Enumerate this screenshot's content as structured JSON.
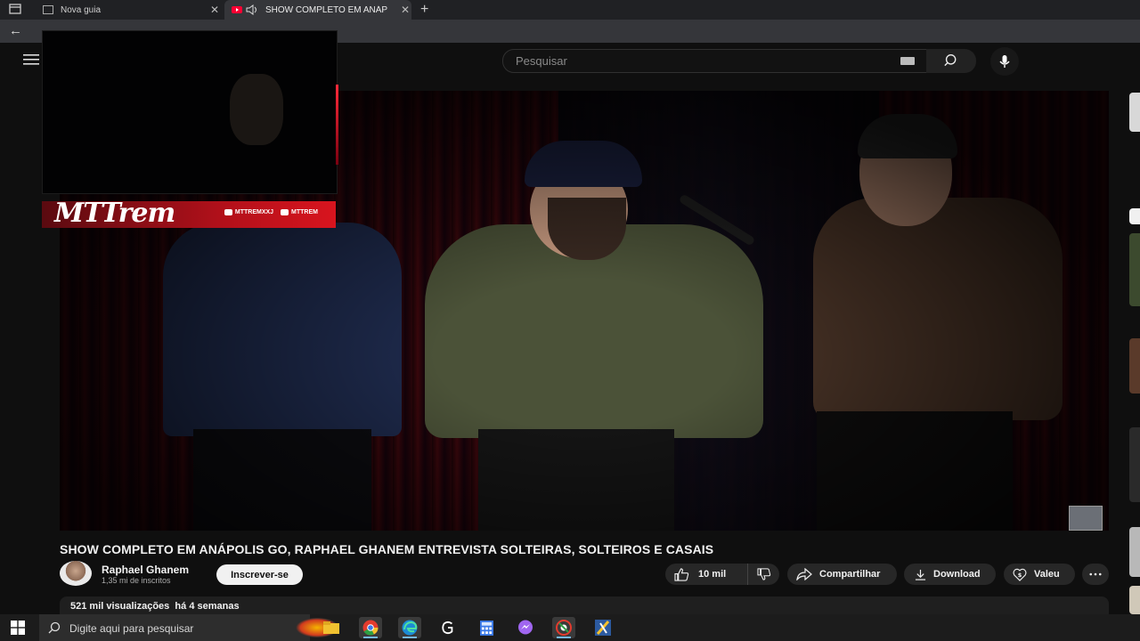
{
  "browser": {
    "tabs": [
      {
        "title": "Nova guia",
        "active": false
      },
      {
        "title": "SHOW COMPLETO EM ANÁP",
        "active": true,
        "playing_audio": true
      }
    ],
    "new_tab_label": "+"
  },
  "header": {
    "search_placeholder": "Pesquisar"
  },
  "overlay": {
    "logo_text": "MTTrem",
    "social_instagram": "MTTREMXXJ",
    "social_youtube": "MTTREM"
  },
  "video": {
    "title": "SHOW COMPLETO EM ANÁPOLIS GO, RAPHAEL GHANEM ENTREVISTA SOLTEIRAS, SOLTEIROS E CASAIS",
    "channel": {
      "name": "Raphael Ghanem",
      "subscribers": "1,35 mi de inscritos"
    },
    "subscribe_label": "Inscrever-se",
    "actions": {
      "likes": "10 mil",
      "share": "Compartilhar",
      "download": "Download",
      "thanks": "Valeu"
    },
    "description": {
      "views": "521 mil visualizações",
      "date": "há 4 semanas"
    }
  },
  "taskbar": {
    "search_placeholder": "Digite aqui para pesquisar",
    "apps": [
      "file-explorer",
      "chrome",
      "edge",
      "app-g",
      "calculator",
      "messenger",
      "chrome-canary",
      "app-k"
    ]
  },
  "colors": {
    "background": "#0f0f0f",
    "pill": "#272727",
    "subscribe_bg": "#f1f1f1",
    "overlay_red": "#d8141e"
  }
}
